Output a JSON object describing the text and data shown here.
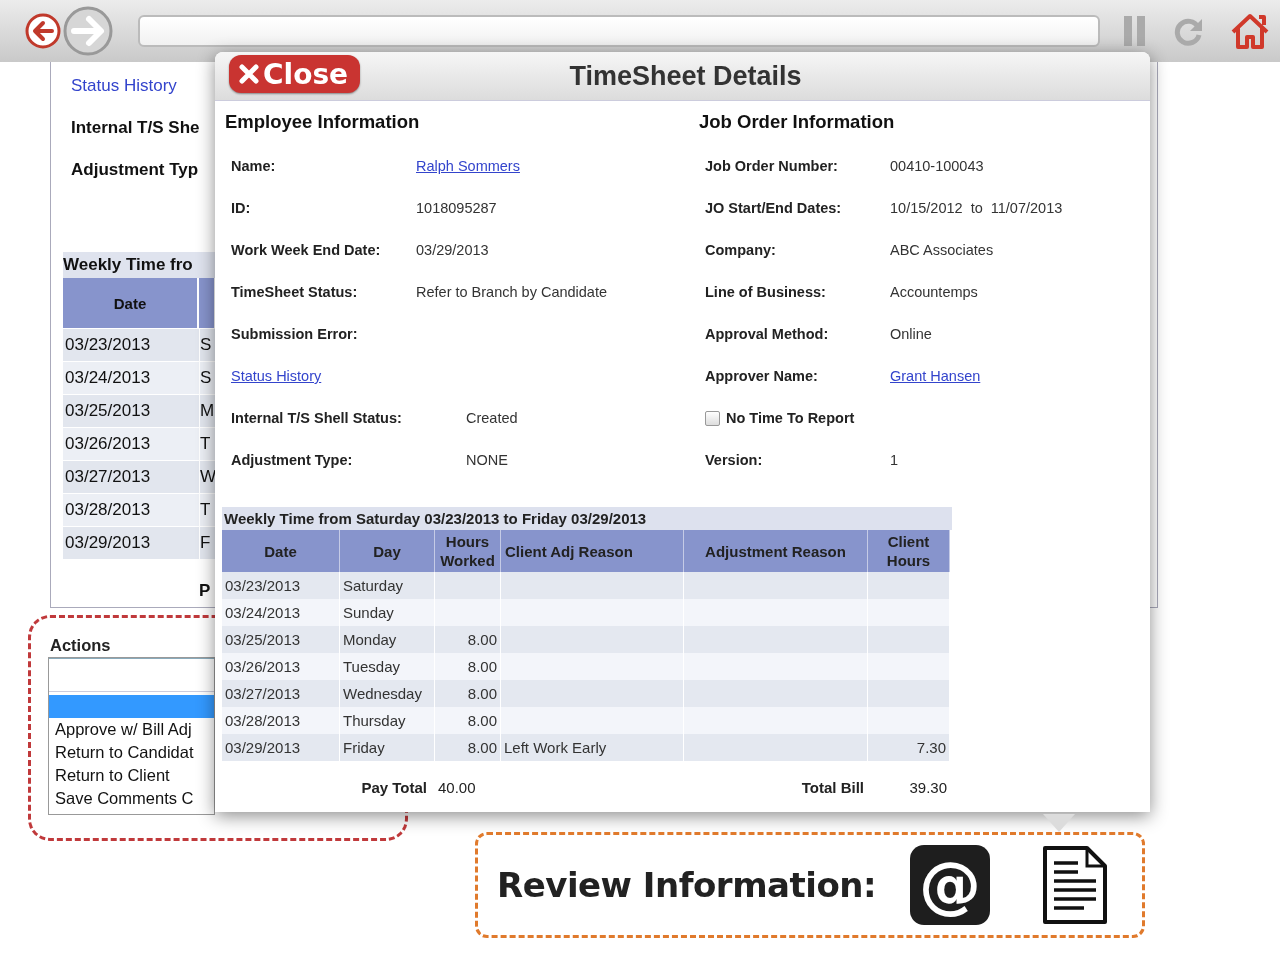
{
  "background_page": {
    "status_link": "Status History",
    "labels": [
      "Internal T/S She",
      "Adjustment Typ"
    ],
    "table": {
      "title": "Weekly Time fro",
      "columns": [
        "Date"
      ],
      "rows": [
        {
          "date": "03/23/2013",
          "day": "S"
        },
        {
          "date": "03/24/2013",
          "day": "S"
        },
        {
          "date": "03/25/2013",
          "day": "M"
        },
        {
          "date": "03/26/2013",
          "day": "T"
        },
        {
          "date": "03/27/2013",
          "day": "W"
        },
        {
          "date": "03/28/2013",
          "day": "T"
        },
        {
          "date": "03/29/2013",
          "day": "F"
        }
      ]
    },
    "pay_total": "P"
  },
  "actions": {
    "title": "Actions",
    "options": [
      {
        "kind": "blank",
        "selected": true
      },
      {
        "kind": "option",
        "label": "Approve w/ Bill Adj",
        "selected": false
      },
      {
        "kind": "option",
        "label": "Return to Candidat",
        "selected": false
      },
      {
        "kind": "option",
        "label": "Return to Client",
        "selected": false
      },
      {
        "kind": "option",
        "label": "Save Comments C",
        "selected": false
      }
    ]
  },
  "modal": {
    "close": "Close",
    "title": "TimeSheet Details",
    "employee": {
      "heading": "Employee Information",
      "rows": [
        {
          "kind": "field",
          "label": "Name:",
          "link": "Ralph Sommers"
        },
        {
          "kind": "field",
          "label": "ID:",
          "value": "1018095287"
        },
        {
          "kind": "field",
          "label": "Work Week End Date:",
          "value": "03/29/2013"
        },
        {
          "kind": "field",
          "label": "TimeSheet Status:",
          "value": "Refer to Branch by Candidate"
        },
        {
          "kind": "field",
          "label": "Submission Error:"
        },
        {
          "kind": "link",
          "label": "Status History"
        },
        {
          "kind": "field",
          "label": "Internal T/S Shell Status:",
          "value": "Created"
        },
        {
          "kind": "field",
          "label": "Adjustment Type:",
          "value": "NONE"
        }
      ]
    },
    "job": {
      "heading": "Job Order Information",
      "rows": [
        {
          "kind": "field",
          "label": "Job Order Number:",
          "value": "00410-100043"
        },
        {
          "kind": "field",
          "label": "JO Start/End Dates:",
          "value": "10/15/2012  to  11/07/2013"
        },
        {
          "kind": "field",
          "label": "Company:",
          "value": "ABC Associates"
        },
        {
          "kind": "field",
          "label": "Line of Business:",
          "value": "Accountemps"
        },
        {
          "kind": "field",
          "label": "Approval Method:",
          "value": "Online"
        },
        {
          "kind": "field",
          "label": "Approver Name:",
          "link": "Grant Hansen"
        },
        {
          "kind": "checkbox",
          "label": "No Time To Report",
          "checked": false
        },
        {
          "kind": "field",
          "label": "Version:",
          "value": "1"
        }
      ]
    },
    "weekly": {
      "title": "Weekly Time from Saturday 03/23/2013 to Friday 03/29/2013",
      "columns": [
        "Date",
        "Day",
        "Hours Worked",
        "Client Adj Reason",
        "Adjustment Reason",
        "Client Hours"
      ],
      "rows": [
        [
          "03/23/2013",
          "Saturday",
          "",
          "",
          "",
          ""
        ],
        [
          "03/24/2013",
          "Sunday",
          "",
          "",
          "",
          ""
        ],
        [
          "03/25/2013",
          "Monday",
          "8.00",
          "",
          "",
          ""
        ],
        [
          "03/26/2013",
          "Tuesday",
          "8.00",
          "",
          "",
          ""
        ],
        [
          "03/27/2013",
          "Wednesday",
          "8.00",
          "",
          "",
          ""
        ],
        [
          "03/28/2013",
          "Thursday",
          "8.00",
          "",
          "",
          ""
        ],
        [
          "03/29/2013",
          "Friday",
          "8.00",
          "Left Work Early",
          "",
          "7.30"
        ]
      ],
      "totals": {
        "pay_label": "Pay Total",
        "pay": "40.00",
        "bill_label": "Total Bill",
        "bill": "39.30"
      }
    }
  },
  "review": {
    "label": "Review Information:",
    "email_symbol": "@"
  }
}
